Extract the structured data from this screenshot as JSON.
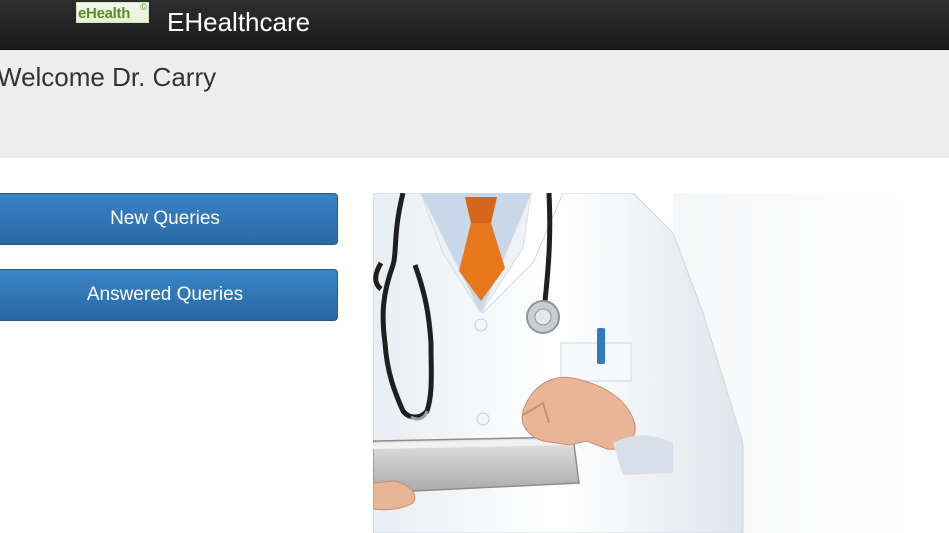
{
  "navbar": {
    "logo_text": "eHealth",
    "logo_mark": "©",
    "brand": "EHealthcare"
  },
  "header": {
    "welcome": "Welcome Dr. Carry"
  },
  "actions": {
    "new_queries": "New Queries",
    "answered_queries": "Answered Queries"
  },
  "colors": {
    "navbar": "#222222",
    "jumbotron": "#eeeeee",
    "button": "#337ab7",
    "logo_green": "#5b8f24",
    "tie": "#e8781e"
  },
  "image": {
    "icon": "doctor-illustration"
  }
}
